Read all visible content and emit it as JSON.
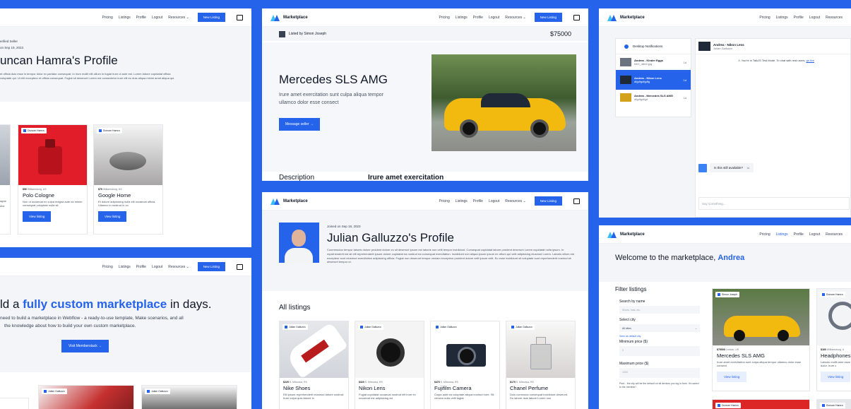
{
  "nav": {
    "pricing": "Pricing",
    "listings": "Listings",
    "profile": "Profile",
    "logout": "Logout",
    "resources": "Resources",
    "new_listing": "New Listing",
    "brand": "Marketplace"
  },
  "p1": {
    "verified": "erified Seller",
    "joined": "on Sep 19, 2023",
    "name": "uncan Hamra's Profile",
    "bio": "et officia duis esse in tempor dolor ex pariatur consequat. In irure mollit elit cillum in fugiat irure ut aute est. Lorem labore cupidatat officia\nvoluptate qui. Ut elit excepteur et officia consequat. Fugiat sit deserunt Lorem est consectetur irure elit eu duis aliqua minim amet aliqua qui.",
    "cards": [
      {
        "partial_meta": "",
        "partial_title": "agne",
        "partial_desc": "olor",
        "seller": "Duncan Hamra",
        "price": "$50",
        "loc": "Williamsburg, US",
        "title": "Polo Cologne",
        "desc": "Non ut occaecat ex culpa magna aute do minim consequat voluptate nulla sit.",
        "btn": "View listing"
      },
      {
        "seller": "Duncan Hamra",
        "price": "$75",
        "loc": "Williamsburg, US",
        "title": "Google Home",
        "desc": "Et dolore adipisicing nulla elit occaecat officia. Ullamco in nostrud in co",
        "btn": "View listing"
      }
    ]
  },
  "p2": {
    "listed_by": "Listed by Simon Joseph",
    "price": "$75000",
    "title": "Mercedes SLS AMG",
    "desc": "Irure amet exercitation sunt culpa aliqua tempor ullamco dolor esse consect",
    "btn": "Message seller →",
    "desc_label": "Description",
    "desc_heading": "Irure amet exercitation"
  },
  "p3": {
    "desktop_notif": "Desktop Notifications",
    "chats": [
      {
        "name": "Andrea - Kinder Eggs",
        "sub": "IMG_4862.jpg",
        "time": "1d"
      },
      {
        "name": "Andrea - Nikon Lens",
        "sub": "dfgdfgdfgdfg",
        "time": "1d"
      },
      {
        "name": "Andrea - Mercedes SLS AMG",
        "sub": "dfgdfgdfgd",
        "time": "1d"
      }
    ],
    "header_name": "Andrea - Nikon Lens",
    "header_sub": "Julian Galluzzo",
    "notice": "You're in TalkJS Test Mode. To chat with real users,",
    "notice_link": "go live",
    "message": "Is this still available?",
    "msg_time": "1d",
    "placeholder": "Say something..."
  },
  "p4": {
    "hero_pre": "ld a ",
    "hero_hl": "fully custom marketplace",
    "hero_post": " in days.",
    "sub1": "need to build a marketplace in Webflow - a ready-to-use template, Make scenarios, and all",
    "sub2": "the knowledge about how to build your own custom marketplace.",
    "btn": "Visit Memberstack →",
    "chip1": "Julian Galluzzo",
    "chip2": "Julian Galluzzo"
  },
  "p5": {
    "joined": "Joined on Sep 18, 2023",
    "name": "Julian Galluzzo's Profile",
    "bio": "Coommodoo tempor laboris dolore proident dolore ex sit deserunt ipsum est laboris non velit tempor incididunt. Consequat cupidatat labore proident deserunt Lorem cupidatat nulla ipsum. In reprehenderit est sit elit reprehenderit ipsum dolore cupidatat ea nostrud ea consequat exercitation. Incididunt non aliqua ipsum ipsum ex cillum qui velit adipisicing eiusmod Lorem. Laboris cillum est excepteur sunt eiusmod exercitation adipisicing officia. Fugiat non deserunt tempor veniam excepteur proident dolore velit ipsum velit. Eu esse incididunt sit voluptate sunt reprehenderit nostrud sit deserunt tempor ut.",
    "all_listings": "All listings",
    "cards": [
      {
        "seller": "Julian Galluzzo",
        "price": "$225",
        "loc": "S. Mitrovica, RS",
        "title": "Nike Shoes",
        "desc": "Elit ipsum reprehenderit eiusmod labore nostrud. Irure culpa quis labore in"
      },
      {
        "seller": "Julian Galluzzo",
        "price": "$320",
        "loc": "S. Mitrovica, RS",
        "title": "Nikon Lens",
        "desc": "Fugiat cupidatat occaecat nostrud elit irure ex occaecat est adipisicing ad"
      },
      {
        "seller": "Julian Galluzzo",
        "price": "$470",
        "loc": "S. Mitrovica, RS",
        "title": "Fujifilm Camera",
        "desc": "Culpa aute ea voluptate aliqua nostrud irure. Sit veniam nulla velit fugiat"
      },
      {
        "seller": "Julian Galluzzo",
        "price": "$170",
        "loc": "S. Mitrovica, RS",
        "title": "Chanel Perfume",
        "desc": "Duis commodo consequat incididunt deserunt. Do labore duis labore Lorem non"
      }
    ]
  },
  "p6": {
    "welcome": "Welcome to the marketplace, ",
    "user": "Andrea",
    "filter_title": "Filter listings",
    "search_label": "Search by name",
    "search_ph": "Shoes, hats, etc.",
    "city_label": "Select city",
    "city_value": "All cities",
    "save_default": "Save as default city",
    "min_label": "Minimum price ($)",
    "min_ph": "0",
    "max_label": "Maximum price ($)",
    "max_ph": "1000",
    "psst": "Psst... the city will be the default on all devices you log in from. It's saved to the member!",
    "cards": [
      {
        "seller": "Simon Joseph",
        "price": "$75000",
        "loc": "London, UK",
        "title": "Mercedes SLS AMG",
        "desc": "Irure amet exercitation sunt culpa aliqua tempor ullamco dolor esse consect",
        "btn": "View listing"
      },
      {
        "seller": "Duncan Hamra",
        "price": "$160",
        "loc": "Williamsburg, U",
        "title": "Headphones",
        "desc": "Laboris mollit ame esse dolor. Irure c",
        "btn": "View listing"
      }
    ],
    "chip_b1": "Duncan Hamra",
    "chip_b2": "Duncan Hamra"
  }
}
